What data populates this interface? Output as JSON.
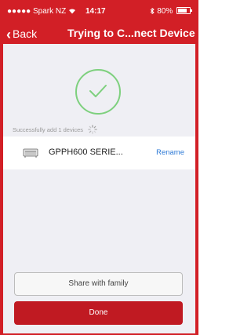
{
  "status_bar": {
    "signal": "●●●●●",
    "carrier": "Spark NZ",
    "time": "14:17",
    "battery": "80%",
    "battery_level": 0.8
  },
  "nav": {
    "back_label": "Back",
    "title": "Trying to C...nect Device"
  },
  "result": {
    "message": "Successfully add 1 devices"
  },
  "device": {
    "name": "GPPH600 SERIE...",
    "rename_label": "Rename"
  },
  "actions": {
    "share_label": "Share with family",
    "done_label": "Done"
  },
  "colors": {
    "brand_red": "#d21f26",
    "done_red": "#c01a22",
    "success_green": "#7ed07e",
    "link_blue": "#2d7ad6"
  }
}
